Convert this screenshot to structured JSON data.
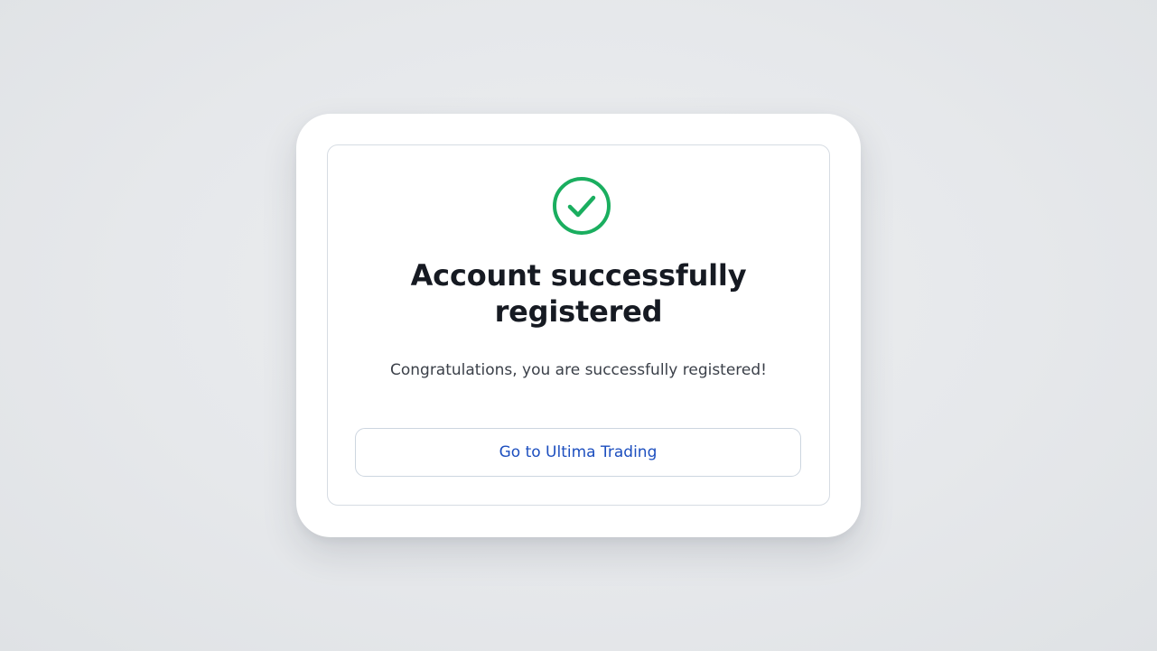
{
  "dialog": {
    "icon": "check-circle-icon",
    "title_line1": "Account successfully",
    "title_line2": "registered",
    "message": "Congratulations, you are successfully registered!",
    "button_label": "Go to Ultima Trading"
  },
  "colors": {
    "success": "#1aae5f",
    "link": "#1d4fbf",
    "title": "#161a22",
    "text": "#3b4049",
    "background": "#e6e8eb"
  }
}
